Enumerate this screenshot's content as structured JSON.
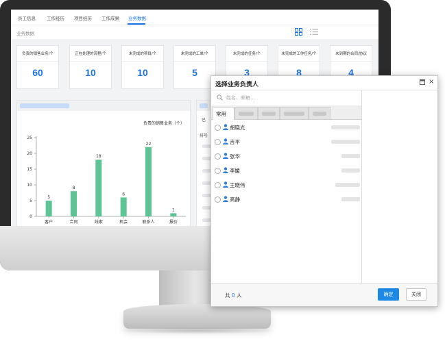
{
  "app": {
    "tabs": [
      {
        "label": "员工信息"
      },
      {
        "label": "工作经历"
      },
      {
        "label": "项目经历"
      },
      {
        "label": "工作成果"
      },
      {
        "label": "业务数据"
      }
    ],
    "active_tab": "业务数据",
    "section_title": "业务数据",
    "view_icons": [
      "grid-view-icon",
      "list-view-icon"
    ],
    "accent_color": "#1b73e8"
  },
  "stats": [
    {
      "label": "负责的销售业务/个",
      "value": "60"
    },
    {
      "label": "正在处理的流程/个",
      "value": "10"
    },
    {
      "label": "未完成的项目/个",
      "value": "10"
    },
    {
      "label": "未完成的工单/个",
      "value": "5"
    },
    {
      "label": "未完成的任务/个",
      "value": "3"
    },
    {
      "label": "未完成的工作任务/个",
      "value": "8"
    },
    {
      "label": "未到期的合同/协议",
      "value": "4"
    }
  ],
  "chart_data": {
    "type": "bar",
    "title": "负责的销售业务（个）",
    "categories": [
      "客户",
      "合同",
      "线索",
      "机会",
      "联系人",
      "报价"
    ],
    "values": [
      5,
      8,
      18,
      6,
      22,
      1
    ],
    "ylim": [
      0,
      25
    ],
    "yticks": [
      0,
      5,
      10,
      15,
      20,
      25
    ],
    "bar_color": "#5cc593",
    "grid": false
  },
  "right_panel": {
    "snippets": [
      "已",
      "排号"
    ]
  },
  "dialog": {
    "title": "选择业务负责人",
    "search_placeholder": "姓名、邮箱...",
    "active_tab": "常用",
    "users": [
      {
        "name": "胡晓光"
      },
      {
        "name": "吉平"
      },
      {
        "name": "张华"
      },
      {
        "name": "李媛"
      },
      {
        "name": "王晓伟"
      },
      {
        "name": "高静"
      }
    ],
    "count_prefix": "共",
    "count_value": "0",
    "count_suffix": "人",
    "confirm_label": "确定",
    "close_label": "关闭"
  }
}
